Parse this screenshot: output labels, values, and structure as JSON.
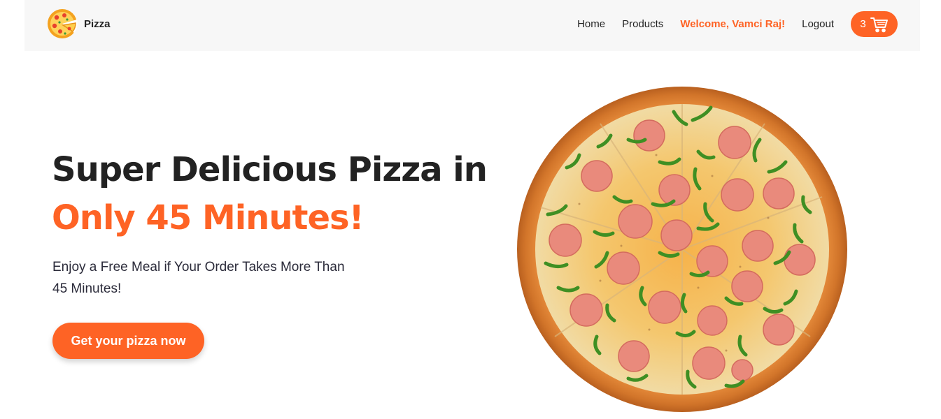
{
  "header": {
    "brand_name": "Pizza",
    "nav": {
      "home": "Home",
      "products": "Products",
      "welcome": "Welcome, Vamci Raj!",
      "logout": "Logout"
    },
    "cart": {
      "count": "3",
      "icon": "cart-icon"
    }
  },
  "hero": {
    "title_line1": "Super Delicious Pizza in",
    "title_line2": "Only 45 Minutes!",
    "subtitle": "Enjoy a Free Meal if Your Order Takes More Than 45 Minutes!",
    "cta_label": "Get your pizza now"
  },
  "colors": {
    "accent": "#fe6325",
    "nav_bg": "#f7f7f7",
    "text": "#222222"
  },
  "icons": [
    "pizza-logo-icon",
    "cart-icon"
  ]
}
